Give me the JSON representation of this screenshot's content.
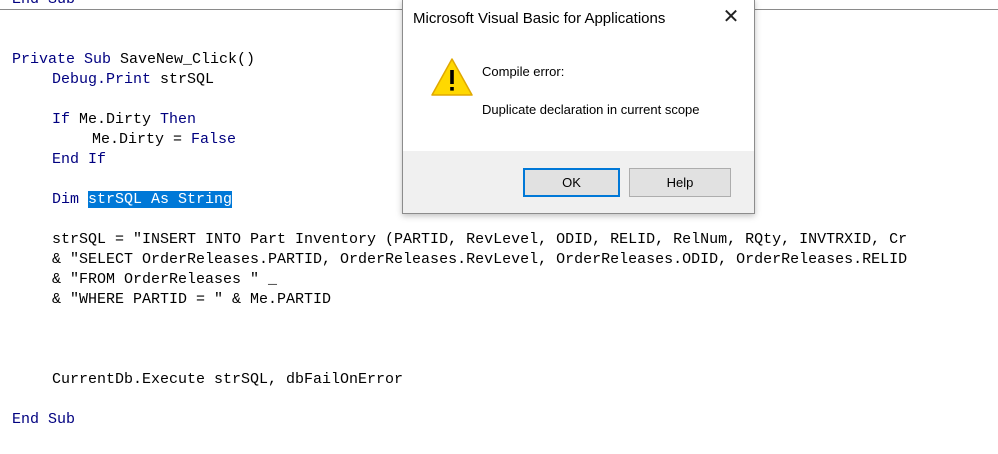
{
  "editor": {
    "top_partial": "End Sub",
    "lines": {
      "sub_decl_kw": "Private Sub",
      "sub_decl_rest": " SaveNew_Click()",
      "debug_kw": "Debug.Print",
      "debug_rest": " strSQL",
      "if_kw": "If",
      "if_mid": " Me.Dirty ",
      "if_then": "Then",
      "dirty_assign": "Me.Dirty = ",
      "dirty_false": "False",
      "end_if": "End If",
      "dim_kw": "Dim",
      "dim_selected": "strSQL As String",
      "sql1": "strSQL = \"INSERT INTO Part Inventory (PARTID, RevLevel, ODID, RELID, RelNum, RQty, INVTRXID, Cr",
      "sql2": "& \"SELECT OrderReleases.PARTID, OrderReleases.RevLevel, OrderReleases.ODID, OrderReleases.RELID",
      "sql3": "& \"FROM OrderReleases \" _",
      "sql4": "& \"WHERE PARTID = \" & Me.PARTID",
      "exec": "CurrentDb.Execute strSQL, dbFailOnError",
      "end_sub": "End Sub"
    }
  },
  "dialog": {
    "title": "Microsoft Visual Basic for Applications",
    "close_glyph": "✕",
    "icon": "warning-icon",
    "message_line1": "Compile error:",
    "message_line2": "Duplicate declaration in current scope",
    "ok_label": "OK",
    "help_label": "Help"
  }
}
